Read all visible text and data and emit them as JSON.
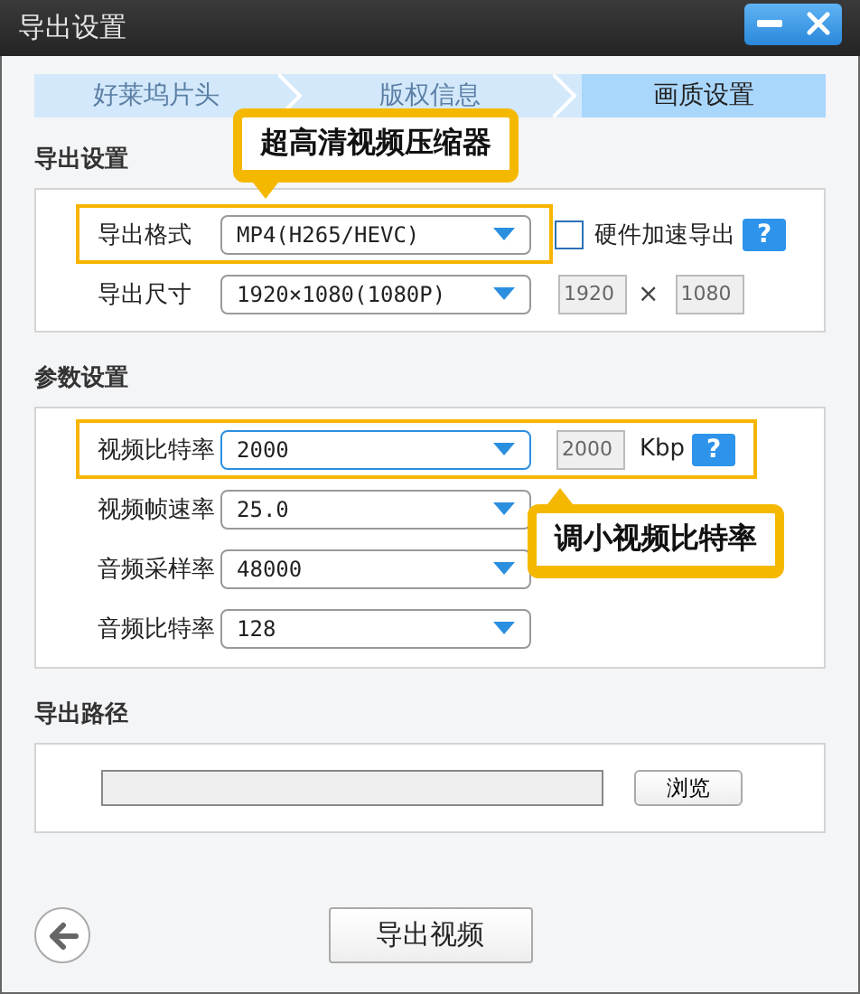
{
  "window": {
    "title": "导出设置"
  },
  "steps": [
    {
      "label": "好莱坞片头",
      "selected": false
    },
    {
      "label": "版权信息",
      "selected": false
    },
    {
      "label": "画质设置",
      "selected": true
    }
  ],
  "sections": [
    {
      "kind": "settings",
      "title": "导出设置",
      "rows": [
        {
          "kind": "checkbox",
          "label": "导出格式",
          "value": "MP4(H265/HEVC)",
          "focused": false,
          "highlighted": true,
          "callout": {
            "text": "超高清视频压缩器"
          },
          "checkbox": {
            "label": "硬件加速导出",
            "checked": false
          },
          "help": "?"
        },
        {
          "kind": "size",
          "label": "导出尺寸",
          "value": "1920×1080(1080P)",
          "focused": false,
          "highlighted": false,
          "inputs": [
            {
              "value": "1920",
              "disabled": true
            },
            {
              "value": "1080",
              "disabled": true
            }
          ],
          "separator": "×"
        }
      ]
    },
    {
      "kind": "settings",
      "title": "参数设置",
      "rows": [
        {
          "kind": "bitrate",
          "label": "视频比特率",
          "value": "2000",
          "focused": true,
          "highlighted": true,
          "callout": {
            "text": "调小视频比特率"
          },
          "input": {
            "value": "2000",
            "disabled": true
          },
          "unit": "Kbp",
          "help": "?"
        },
        {
          "kind": "plain",
          "label": "视频帧速率",
          "value": "25.0",
          "focused": false,
          "highlighted": false
        },
        {
          "kind": "plain",
          "label": "音频采样率",
          "value": "48000",
          "focused": false,
          "highlighted": false
        },
        {
          "kind": "plain",
          "label": "音频比特率",
          "value": "128",
          "focused": false,
          "highlighted": false
        }
      ]
    },
    {
      "kind": "path",
      "title": "导出路径",
      "browse": "浏览"
    }
  ],
  "footer": {
    "export_button": "导出视频"
  }
}
